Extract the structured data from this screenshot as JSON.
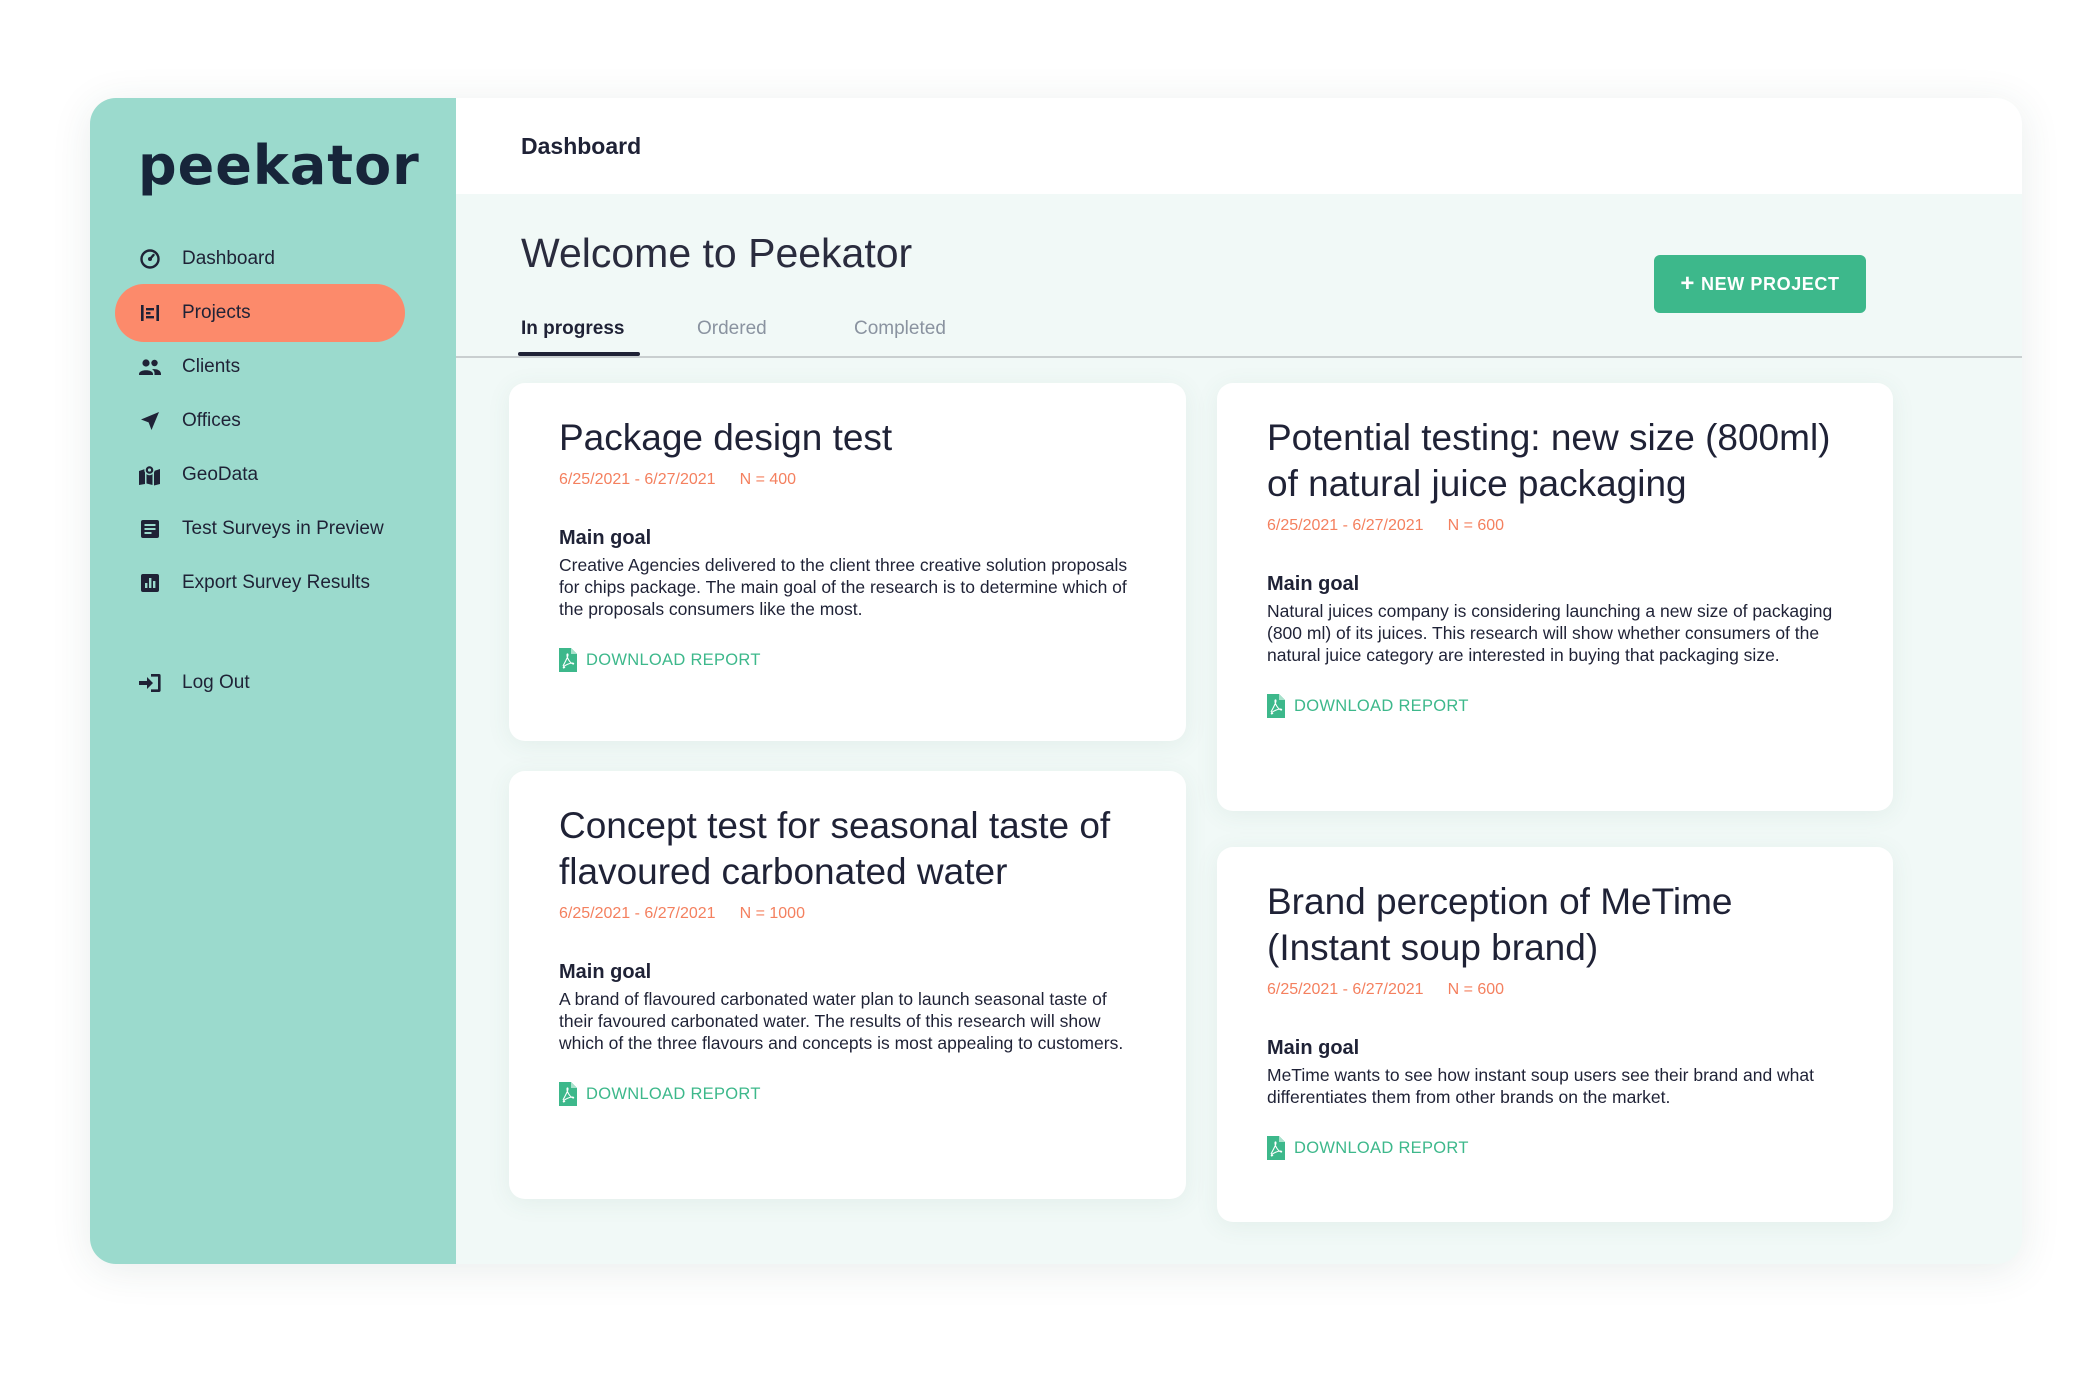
{
  "brand": {
    "logo_text": "peekator"
  },
  "sidebar": {
    "items": [
      {
        "label": "Dashboard",
        "icon": "dashboard-icon"
      },
      {
        "label": "Projects",
        "icon": "projects-icon",
        "active": true
      },
      {
        "label": "Clients",
        "icon": "clients-icon"
      },
      {
        "label": "Offices",
        "icon": "offices-icon"
      },
      {
        "label": "GeoData",
        "icon": "geodata-icon"
      },
      {
        "label": "Test Surveys in Preview",
        "icon": "survey-preview-icon"
      },
      {
        "label": "Export  Survey Results",
        "icon": "export-results-icon"
      }
    ],
    "logout": {
      "label": "Log Out",
      "icon": "logout-icon"
    }
  },
  "topbar": {
    "title": "Dashboard"
  },
  "main": {
    "welcome": "Welcome to Peekator",
    "new_project_button": "NEW PROJECT",
    "tabs": [
      {
        "label": "In progress",
        "active": true
      },
      {
        "label": "Ordered"
      },
      {
        "label": "Completed"
      }
    ]
  },
  "cards": [
    {
      "title": "Package design test",
      "dates": "6/25/2021 - 6/27/2021",
      "n": "N = 400",
      "goal_heading": "Main goal",
      "goal_text": "Creative Agencies delivered to the client three creative solution proposals for chips package. The main goal of the research is to determine which of the proposals consumers like the most.",
      "download_label": "DOWNLOAD REPORT"
    },
    {
      "title": "Concept test for seasonal taste of flavoured carbonated water",
      "dates": "6/25/2021 - 6/27/2021",
      "n": "N = 1000",
      "goal_heading": "Main goal",
      "goal_text": "A brand of flavoured carbonated water plan to launch seasonal taste of their favoured carbonated water. The results of this research will show which of the three flavours and concepts is most appealing to customers.",
      "download_label": "DOWNLOAD REPORT"
    },
    {
      "title": "Potential testing: new size (800ml) of natural juice packaging",
      "dates": "6/25/2021 - 6/27/2021",
      "n": "N = 600",
      "goal_heading": "Main goal",
      "goal_text": "Natural juices company is considering launching a new size of packaging (800 ml) of its juices. This research will show whether consumers of the natural juice category are interested in buying that packaging size.",
      "download_label": "DOWNLOAD REPORT"
    },
    {
      "title": "Brand perception of MeTime (Instant soup brand)",
      "dates": "6/25/2021 - 6/27/2021",
      "n": "N = 600",
      "goal_heading": "Main goal",
      "goal_text": "MeTime wants to see how instant soup users see their brand and what differentiates them from other brands on the market.",
      "download_label": "DOWNLOAD REPORT"
    }
  ],
  "colors": {
    "sidebar_bg": "#9bdacd",
    "active_nav": "#fc8a6b",
    "accent_green": "#3db88b",
    "meta_orange": "#f4805f",
    "text_dark": "#1f2236"
  }
}
